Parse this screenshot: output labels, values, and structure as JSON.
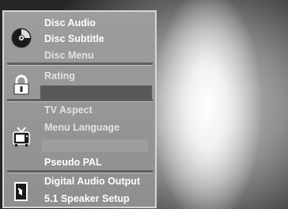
{
  "menu": {
    "disc": {
      "icon": "disc-icon",
      "items": [
        {
          "label": "Disc Audio",
          "style": "white"
        },
        {
          "label": "Disc Subtitle",
          "style": "white"
        },
        {
          "label": "Disc Menu",
          "style": "gray"
        }
      ]
    },
    "rating": {
      "icon": "padlock-icon",
      "items": [
        {
          "label": "Rating",
          "style": "gray"
        }
      ],
      "selected_row": ""
    },
    "tv": {
      "icon": "tv-icon",
      "items": [
        {
          "label": "TV Aspect",
          "style": "gray"
        },
        {
          "label": "Menu Language",
          "style": "gray"
        },
        {
          "label": "Pseudo PAL",
          "style": "white"
        }
      ]
    },
    "audio": {
      "icon": "speaker-icon",
      "items": [
        {
          "label": "Digital Audio Output",
          "style": "white"
        },
        {
          "label": "5.1 Speaker Setup",
          "style": "white"
        }
      ]
    }
  },
  "colors": {
    "panel": "#959595",
    "highlight": "#585858",
    "text_primary": "#ffffff",
    "text_secondary": "#e2e2e2"
  }
}
